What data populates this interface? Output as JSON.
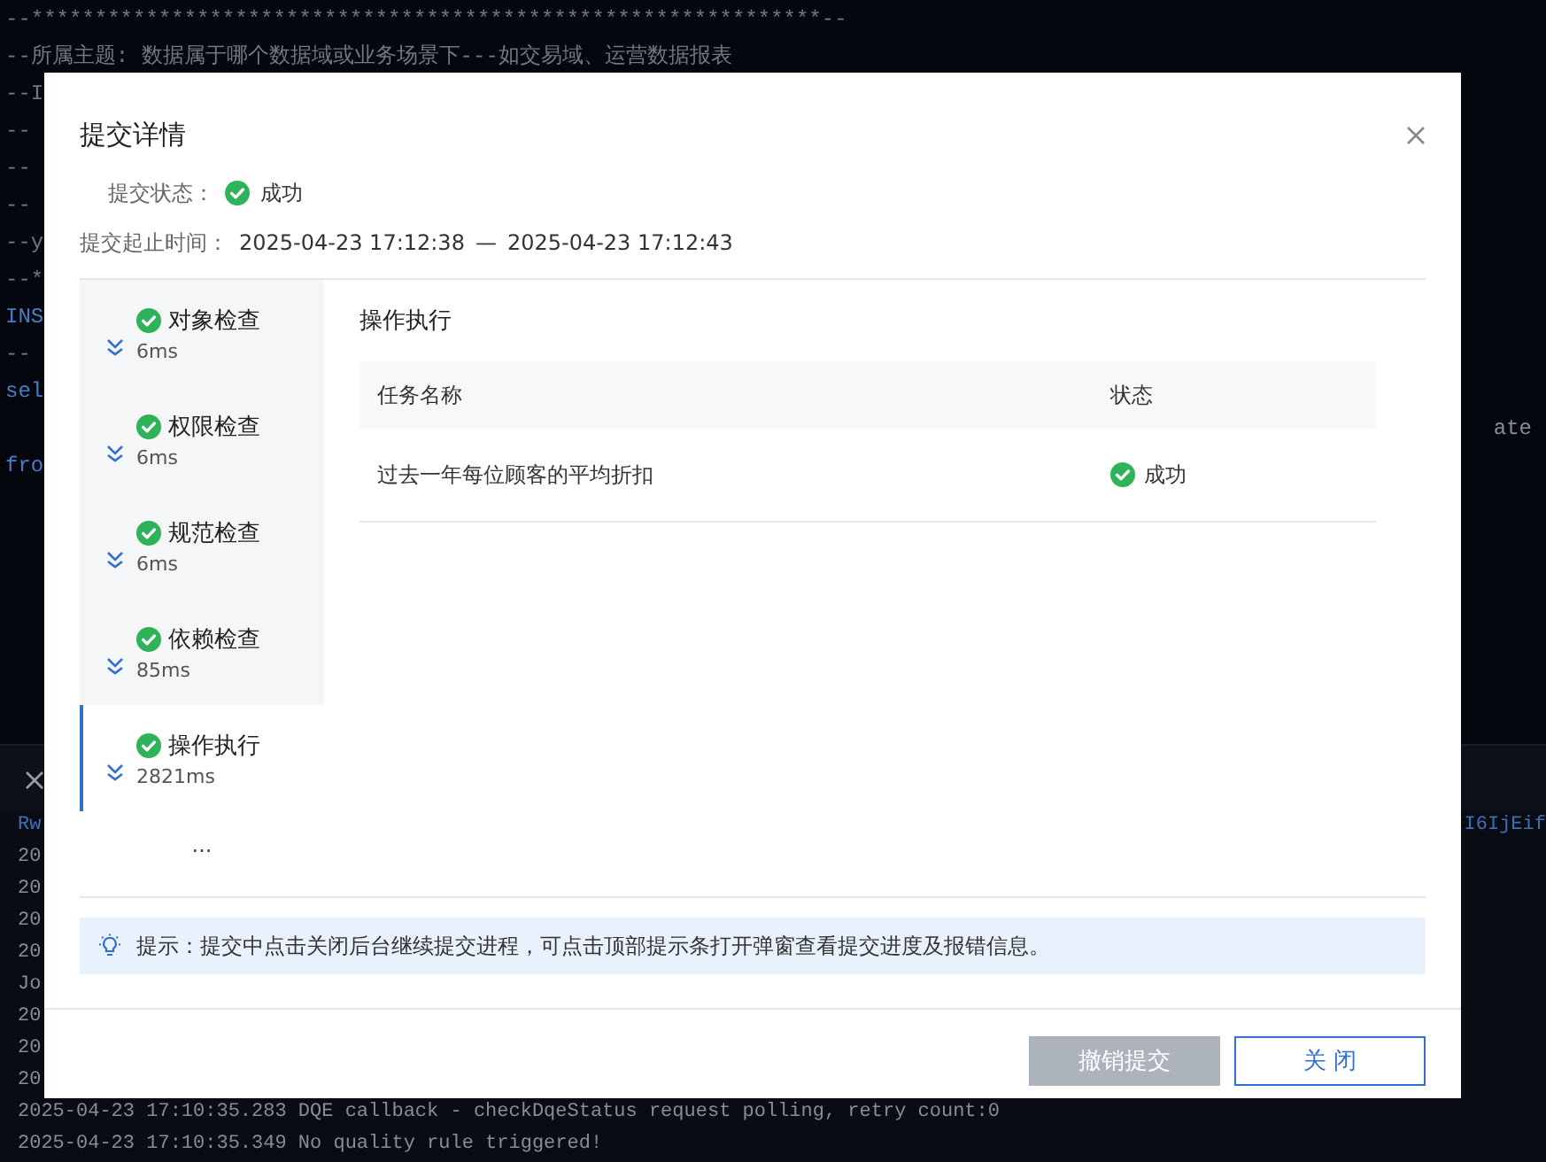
{
  "editor": {
    "lines": [
      {
        "text": "--**************************************************************--",
        "kind": "comment"
      },
      {
        "text": "--所属主题: 数据属于哪个数据域或业务场景下---如交易域、运营数据报表",
        "kind": "comment"
      },
      {
        "text": "--I",
        "kind": "comment"
      },
      {
        "text": "--",
        "kind": "comment"
      },
      {
        "text": "--",
        "kind": "comment"
      },
      {
        "text": "--",
        "kind": "comment"
      },
      {
        "text": "--y",
        "kind": "comment"
      },
      {
        "text": "--*",
        "kind": "comment"
      },
      {
        "text": "INS",
        "kind": "keyword"
      },
      {
        "text": "--",
        "kind": "comment"
      },
      {
        "text": "sel",
        "kind": "keyword"
      },
      {
        "right": "ate",
        "kind": "code"
      },
      {
        "text": "fro",
        "kind": "keyword"
      }
    ]
  },
  "log_panel": {
    "tab": "Rw",
    "tab_right": "I6IjEif",
    "lines": [
      "20",
      "20",
      "20",
      "20",
      "Jo",
      "20",
      "20",
      "20",
      "2025-04-23 17:10:35.283 DQE callback - checkDqeStatus request polling, retry count:0",
      "2025-04-23 17:10:35.349 No quality rule triggered!"
    ]
  },
  "dialog": {
    "title": "提交详情",
    "status": {
      "label": "提交状态：",
      "value": "成功",
      "succeeded": true
    },
    "time_range": {
      "label": "提交起止时间：",
      "start": "2025-04-23 17:12:38",
      "separator": "—",
      "end": "2025-04-23 17:12:43"
    },
    "steps": [
      {
        "name": "对象检查",
        "duration": "6ms",
        "succeeded": true,
        "selected": false
      },
      {
        "name": "权限检查",
        "duration": "6ms",
        "succeeded": true,
        "selected": false
      },
      {
        "name": "规范检查",
        "duration": "6ms",
        "succeeded": true,
        "selected": false
      },
      {
        "name": "依赖检查",
        "duration": "85ms",
        "succeeded": true,
        "selected": false
      },
      {
        "name": "操作执行",
        "duration": "2821ms",
        "succeeded": true,
        "selected": true
      }
    ],
    "more": "...",
    "detail": {
      "title": "操作执行",
      "columns": [
        "任务名称",
        "状态"
      ],
      "rows": [
        {
          "task": "过去一年每位顾客的平均折扣",
          "status": "成功",
          "succeeded": true
        }
      ]
    },
    "tip": "提示：提交中点击关闭后台继续提交进程，可点击顶部提示条打开弹窗查看提交进度及报错信息。",
    "buttons": [
      {
        "label": "撤销提交",
        "kind": "secondary",
        "disabled": true
      },
      {
        "label": "关 闭",
        "kind": "outline",
        "disabled": false
      }
    ]
  }
}
